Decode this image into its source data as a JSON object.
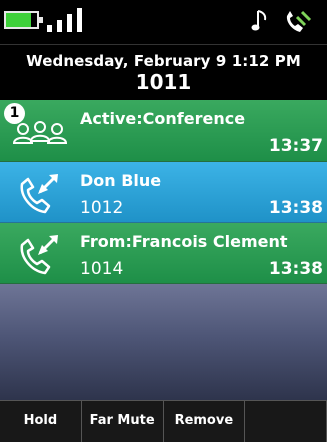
{
  "status_bar": {
    "battery_level": 0.8,
    "signal_bars": 4,
    "icons": [
      "battery-icon",
      "signal-icon",
      "ringtone-note-icon",
      "handset-status-icon"
    ]
  },
  "header": {
    "datetime": "Wednesday, February 9 1:12 PM",
    "extension": "1011"
  },
  "calls": [
    {
      "type": "conference",
      "icon": "conference-icon",
      "badge": "1",
      "name": "Active:Conference",
      "number": "",
      "duration": "13:37",
      "color": "#2e9f55"
    },
    {
      "type": "call",
      "icon": "call-handset-icon",
      "name": "Don Blue",
      "number": "1012",
      "duration": "13:38",
      "color": "#2aa6dc"
    },
    {
      "type": "call",
      "icon": "call-handset-icon",
      "name": "From:Francois Clement",
      "number": "1014",
      "duration": "13:38",
      "color": "#2e9f55"
    }
  ],
  "softkeys": [
    "Hold",
    "Far Mute",
    "Remove",
    ""
  ]
}
